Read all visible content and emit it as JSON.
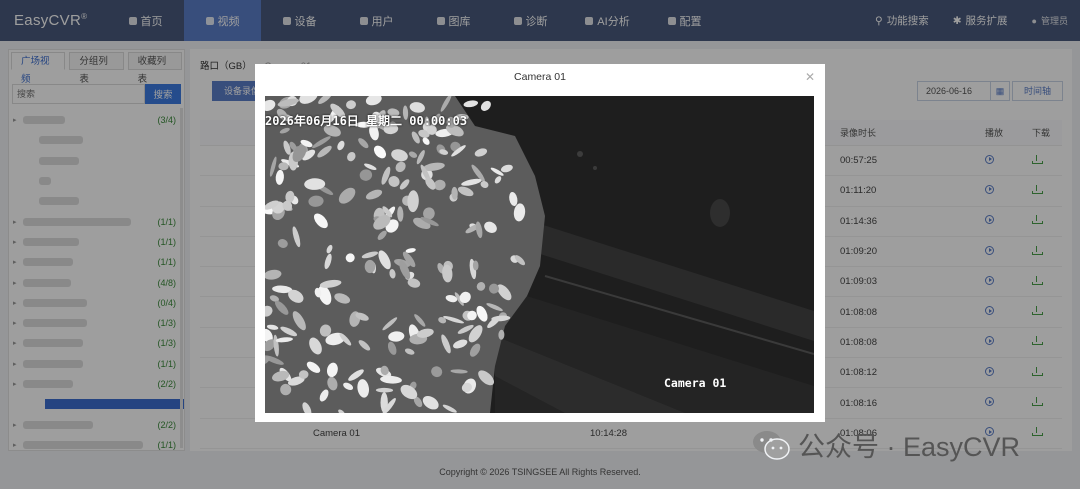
{
  "app": {
    "logo": "EasyCVR",
    "logo_mark": "®"
  },
  "nav": {
    "items": [
      {
        "label": "首页",
        "icon": "cloud-icon",
        "active": false
      },
      {
        "label": "视频",
        "icon": "circle-icon",
        "active": true
      },
      {
        "label": "设备",
        "icon": "device-icon",
        "active": false
      },
      {
        "label": "用户",
        "icon": "user-icon",
        "active": false
      },
      {
        "label": "图库",
        "icon": "gallery-icon",
        "active": false
      },
      {
        "label": "诊断",
        "icon": "pulse-icon",
        "active": false
      },
      {
        "label": "AI分析",
        "icon": "ai-icon",
        "active": false
      },
      {
        "label": "配置",
        "icon": "gear-icon",
        "active": false
      }
    ],
    "search_label": "功能搜索",
    "ext_label": "服务扩展",
    "user_label": "管理员"
  },
  "sidebar": {
    "tabs": [
      "广场视频",
      "分组列表",
      "收藏列表"
    ],
    "search_placeholder": "搜索",
    "search_button": "搜索",
    "counts": [
      "(3/4)",
      "",
      "",
      "",
      "",
      "(1/1)",
      "(1/1)",
      "(1/1)",
      "(4/8)",
      "(0/4)",
      "(1/3)",
      "(1/3)",
      "(1/1)",
      "(2/2)",
      "",
      "(2/2)",
      "(1/1)"
    ]
  },
  "main": {
    "breadcrumb_root": "路口（GB）",
    "breadcrumb_current": "Camera 01",
    "device_button": "设备录像",
    "date_value": "2026-06-16",
    "timeline_button": "时间轴",
    "columns": {
      "duration": "录像时长",
      "play": "播放",
      "download": "下载"
    },
    "durations": [
      "00:57:25",
      "01:11:20",
      "01:14:36",
      "01:09:20",
      "01:09:03",
      "01:08:08",
      "01:08:08",
      "01:08:12",
      "01:08:16"
    ],
    "last_row": {
      "name": "Camera 01",
      "time": "10:14:28",
      "duration": "01:08:06"
    }
  },
  "footer": "Copyright © 2026 TSINGSEE All Rights Reserved.",
  "modal": {
    "title": "Camera 01",
    "osd_time": "2026年06月16日 星期二 00:00:03",
    "osd_name": "Camera 01"
  },
  "watermark": {
    "text": "公众号 · EasyCVR"
  }
}
